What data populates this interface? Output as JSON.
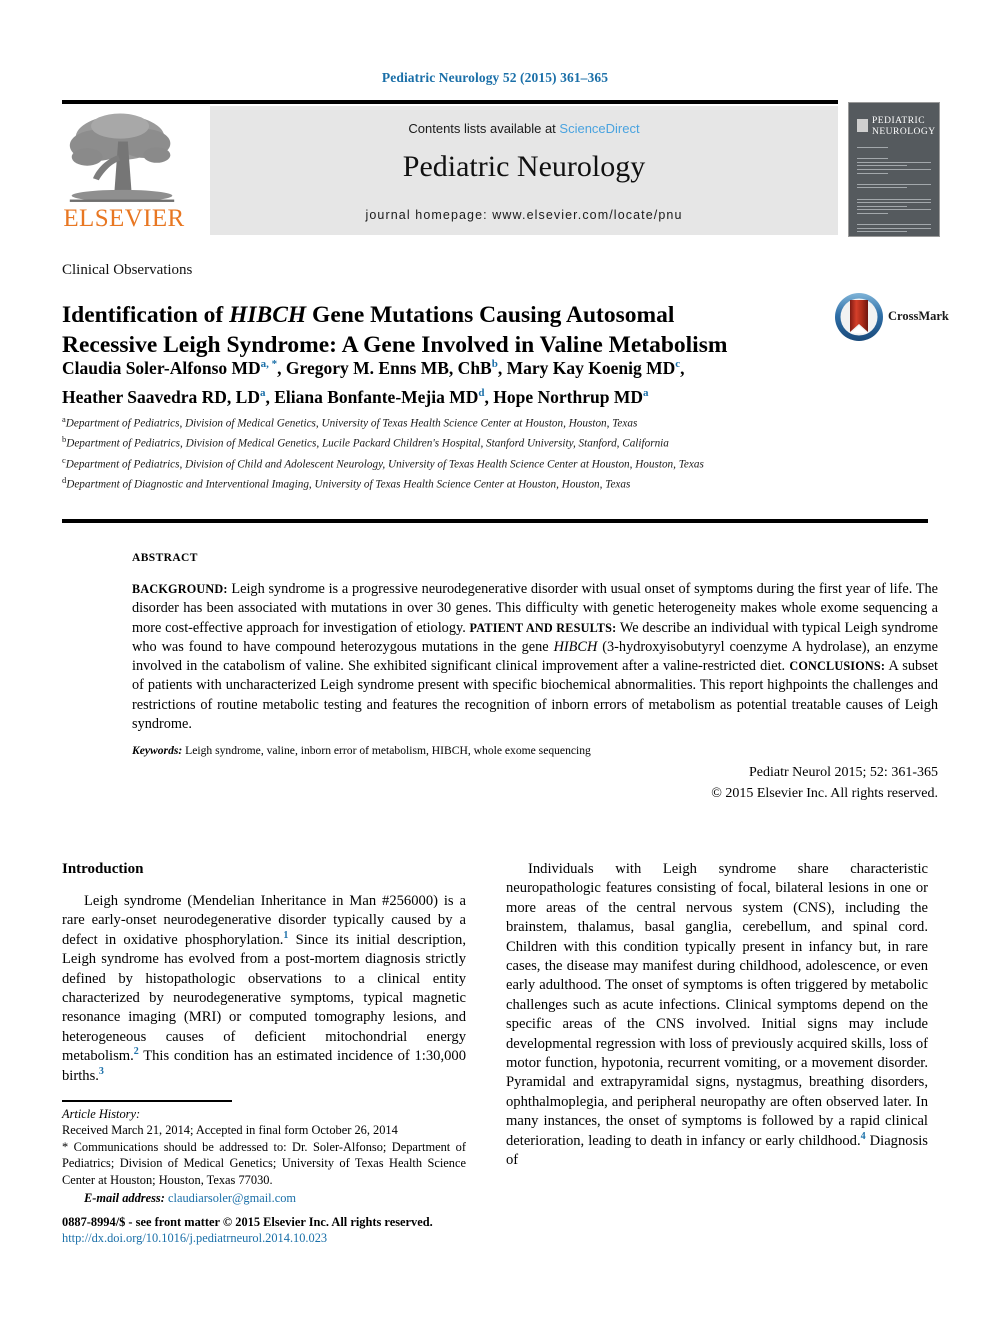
{
  "running_head": "Pediatric Neurology 52 (2015) 361–365",
  "masthead": {
    "contents_prefix": "Contents lists available at ",
    "sciencedirect": "ScienceDirect",
    "journal_title": "Pediatric Neurology",
    "homepage": "journal homepage: www.elsevier.com/locate/pnu",
    "publisher_name": "ELSEVIER",
    "publisher_color": "#E87722",
    "link_color": "#4aa3df",
    "banner_bg": "#e6e6e6",
    "cover_title_line1": "PEDIATRIC",
    "cover_title_line2": "NEUROLOGY"
  },
  "article": {
    "section_label": "Clinical Observations",
    "title_part1": "Identification of ",
    "title_gene": "HIBCH",
    "title_part2": " Gene Mutations Causing Autosomal Recessive Leigh Syndrome: A Gene Involved in Valine Metabolism",
    "crossmark_label": "CrossMark",
    "authors_line1": "Claudia Soler-Alfonso MD a, *, Gregory M. Enns MB, ChB b, Mary Kay Koenig MD c,",
    "authors_line2": "Heather Saavedra RD, LD a, Eliana Bonfante-Mejia MD d, Hope Northrup MD a",
    "affiliations": [
      {
        "marker": "a",
        "text": "Department of Pediatrics, Division of Medical Genetics, University of Texas Health Science Center at Houston, Houston, Texas"
      },
      {
        "marker": "b",
        "text": "Department of Pediatrics, Division of Medical Genetics, Lucile Packard Children's Hospital, Stanford University, Stanford, California"
      },
      {
        "marker": "c",
        "text": "Department of Pediatrics, Division of Child and Adolescent Neurology, University of Texas Health Science Center at Houston, Houston, Texas"
      },
      {
        "marker": "d",
        "text": "Department of Diagnostic and Interventional Imaging, University of Texas Health Science Center at Houston, Houston, Texas"
      }
    ]
  },
  "abstract": {
    "label": "ABSTRACT",
    "background_label": "BACKGROUND:",
    "background_text": " Leigh syndrome is a progressive neurodegenerative disorder with usual onset of symptoms during the first year of life. The disorder has been associated with mutations in over 30 genes. This difficulty with genetic heterogeneity makes whole exome sequencing a more cost-effective approach for investigation of etiology. ",
    "patient_label": "PATIENT AND RESULTS:",
    "patient_text_a": " We describe an individual with typical Leigh syndrome who was found to have compound heterozygous mutations in the gene ",
    "patient_gene": "HIBCH",
    "patient_text_b": " (3-hydroxyisobutyryl coenzyme A hydrolase), an enzyme involved in the catabolism of valine. She exhibited significant clinical improvement after a valine-restricted diet. ",
    "conclusions_label": "CONCLUSIONS:",
    "conclusions_text": " A subset of patients with uncharacterized Leigh syndrome present with specific biochemical abnormalities. This report highpoints the challenges and restrictions of routine metabolic testing and features the recognition of inborn errors of metabolism as potential treatable causes of Leigh syndrome.",
    "keywords_label": "Keywords:",
    "keywords_text": " Leigh syndrome, valine, inborn error of metabolism, HIBCH, whole exome sequencing",
    "citation": "Pediatr Neurol 2015; 52: 361-365",
    "copyright": "© 2015 Elsevier Inc. All rights reserved."
  },
  "body": {
    "left_heading": "Introduction",
    "left_paragraph_a": "Leigh syndrome (Mendelian Inheritance in Man #256000) is a rare early-onset neurodegenerative disorder typically caused by a defect in oxidative phosphorylation.",
    "left_ref_1": "1",
    "left_paragraph_b": " Since its initial description, Leigh syndrome has evolved from a post-mortem diagnosis strictly defined by histopathologic observations to a clinical entity characterized by neurodegenerative symptoms, typical magnetic resonance imaging (MRI) or computed tomography lesions, and heterogeneous causes of deficient mitochondrial energy metabolism.",
    "left_ref_2": "2",
    "left_paragraph_c": " This condition has an estimated incidence of 1:30,000 births.",
    "left_ref_3": "3",
    "right_paragraph_a": "Individuals with Leigh syndrome share characteristic neuropathologic features consisting of focal, bilateral lesions in one or more areas of the central nervous system (CNS), including the brainstem, thalamus, basal ganglia, cerebellum, and spinal cord. Children with this condition typically present in infancy but, in rare cases, the disease may manifest during childhood, adolescence, or even early adulthood. The onset of symptoms is often triggered by metabolic challenges such as acute infections. Clinical symptoms depend on the specific areas of the CNS involved. Initial signs may include developmental regression with loss of previously acquired skills, loss of motor function, hypotonia, recurrent vomiting, or a movement disorder. Pyramidal and extrapyramidal signs, nystagmus, breathing disorders, ophthalmoplegia, and peripheral neuropathy are often observed later. In many instances, the onset of symptoms is followed by a rapid clinical deterioration, leading to death in infancy or early childhood.",
    "right_ref_4": "4",
    "right_paragraph_b": " Diagnosis of"
  },
  "footer": {
    "history_label": "Article History:",
    "history_text": "Received March 21, 2014; Accepted in final form October 26, 2014",
    "correspondence": "* Communications should be addressed to: Dr. Soler-Alfonso; Department of Pediatrics; Division of Medical Genetics; University of Texas Health Science Center at Houston; Houston, Texas 77030.",
    "email_label": "E-mail address:",
    "email": "claudiarsoler@gmail.com",
    "issn_line": "0887-8994/$ - see front matter © 2015 Elsevier Inc. All rights reserved.",
    "doi_line": "http://dx.doi.org/10.1016/j.pediatrneurol.2014.10.023",
    "link_color": "#1a6fa8"
  }
}
